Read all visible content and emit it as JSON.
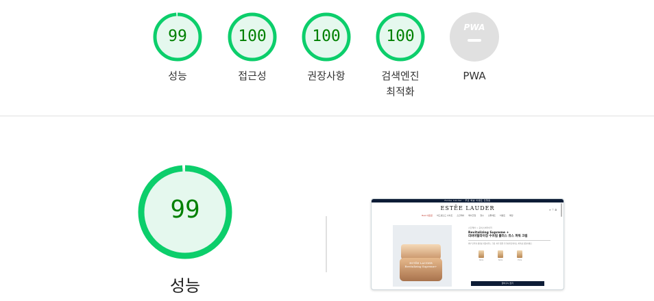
{
  "colors": {
    "pass": "#0cce6b",
    "pass_bg": "#e5f8ee",
    "pass_text": "#008000",
    "na": "#e0e0e0",
    "na_text": "#ffffff"
  },
  "categories": [
    {
      "label": "성능",
      "score": "99",
      "fraction": 0.99
    },
    {
      "label": "접근성",
      "score": "100",
      "fraction": 1.0
    },
    {
      "label": "권장사항",
      "score": "100",
      "fraction": 1.0
    },
    {
      "label": "검색엔진\n최적화",
      "score": "100",
      "fraction": 1.0
    },
    {
      "label": "PWA",
      "score": "",
      "icon_text": "PWA",
      "icon": "pwa-na-icon"
    }
  ],
  "performance": {
    "label": "성능",
    "score": "99",
    "fraction": 0.99
  },
  "screenshot": {
    "topbar": "Estée Lauder · 무료 배송 이벤트 진행중",
    "brand": "ESTĒE LAUDER",
    "icons": "⌕ ♡ ⍝",
    "nav": [
      "Best 새로운",
      "어드밴스드 나이트",
      "스킨케어",
      "메이크업",
      "향수",
      "선물세트",
      "이벤트",
      "매장"
    ],
    "category": "스킨케어 > 모이스처라이저",
    "title": "Revitalizing Supreme +\n리바이탈라이징 수프림 플러스 유스 파워 크림",
    "desc": "피부 탄력과 생기를 되찾아주는 크림. 하루 종일 촉촉하게 유지되는 피부를 경험하세요.",
    "jar_text": "ESTĒE LAUDER\nRevitalizing Supreme+",
    "thumbs": [
      "30ml",
      "50ml",
      "75ml"
    ],
    "button": "장바구니 담기"
  }
}
